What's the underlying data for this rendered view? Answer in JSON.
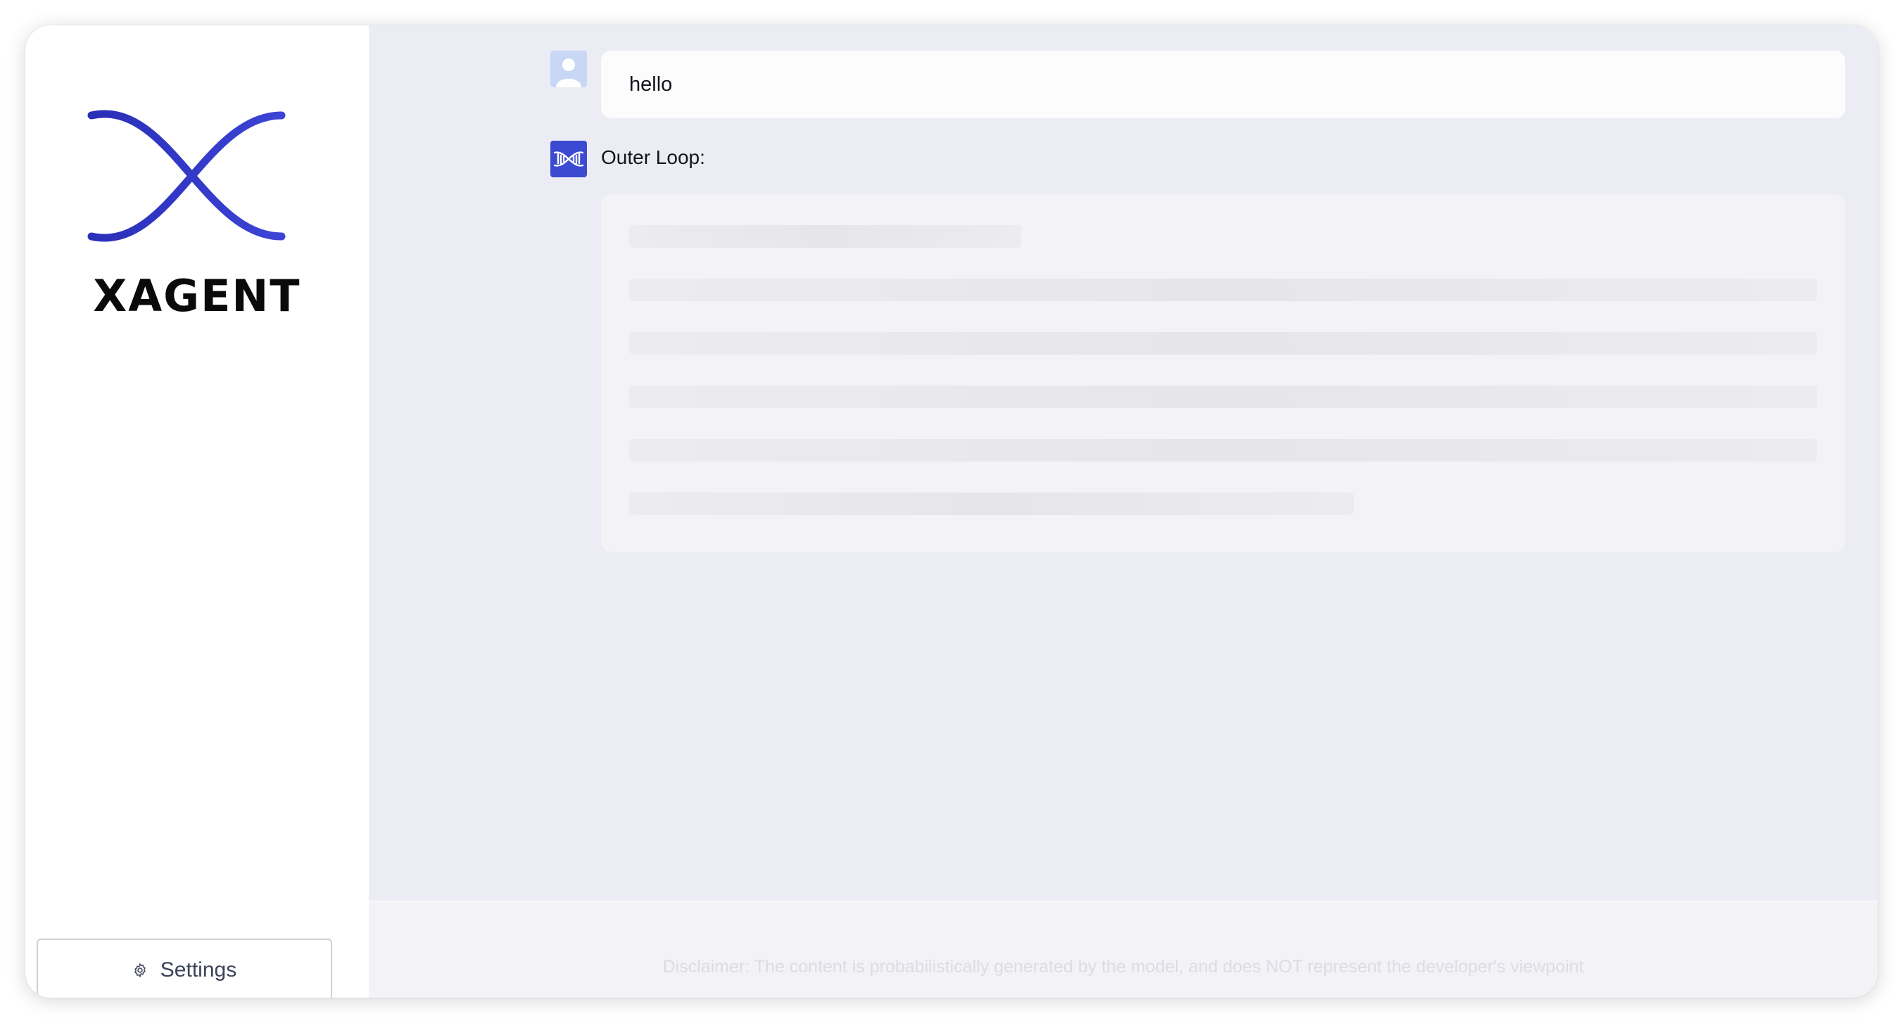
{
  "sidebar": {
    "brand": "XAGENT",
    "logo_icon": "dna-helix-icon",
    "settings_label": "Settings",
    "settings_icon": "gear-icon"
  },
  "chat": {
    "user_message": "hello",
    "user_avatar_icon": "user-avatar-icon",
    "agent_avatar_icon": "xagent-logo-icon",
    "agent_title": "Outer Loop:",
    "loading_lines": [
      {
        "fill": 0.33
      },
      {
        "fill": 1.0
      },
      {
        "fill": 1.0
      },
      {
        "fill": 1.0
      },
      {
        "fill": 1.0
      },
      {
        "fill": 0.61
      }
    ]
  },
  "footer": {
    "disclaimer": "Disclaimer: The content is probabilistically generated by the model, and does NOT represent the developer's viewpoint"
  },
  "colors": {
    "brand_blue": "#3b3fd0",
    "brand_blue_dark": "#2a2fb8",
    "main_bg": "#ececf4",
    "sidebar_bg": "#ffffff"
  }
}
